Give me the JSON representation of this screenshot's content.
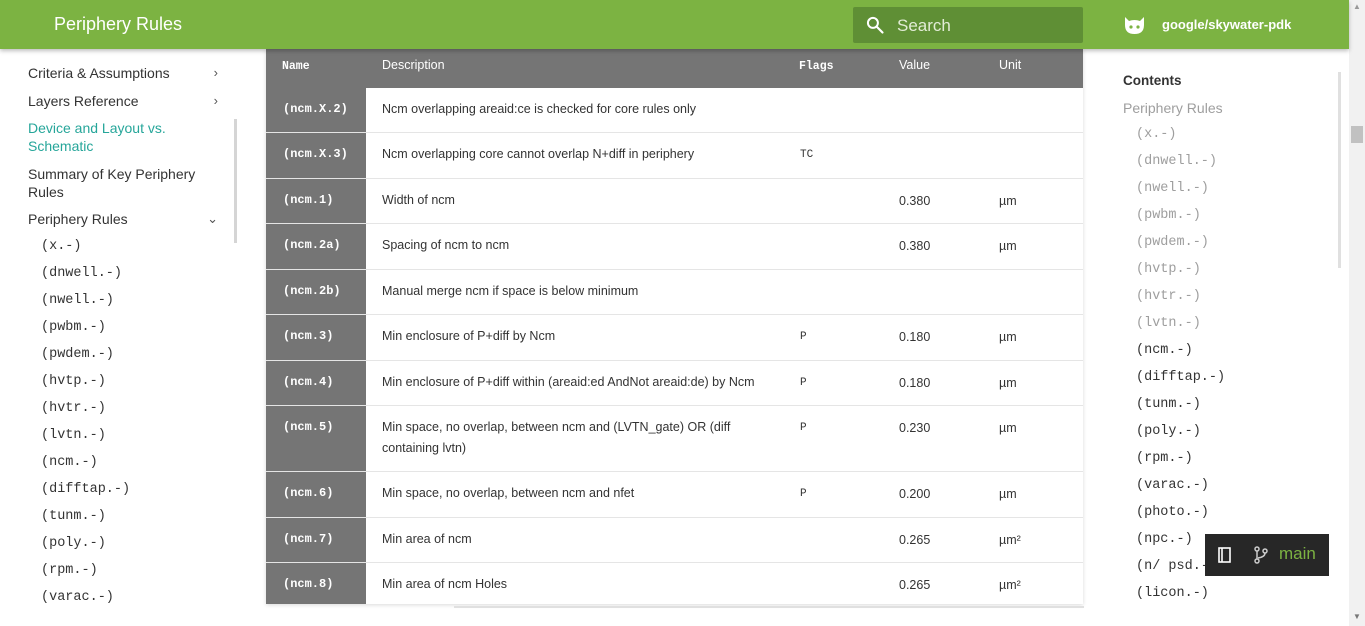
{
  "header": {
    "title": "Periphery Rules",
    "search_placeholder": "Search",
    "repo_name": "google/skywater-pdk",
    "bg_color": "#7cb342"
  },
  "sidebar": {
    "items": [
      {
        "label": "Criteria & Assumptions",
        "chevron": "›"
      },
      {
        "label": "Layers Reference",
        "chevron": "›"
      },
      {
        "label": "Device and Layout vs. Schematic",
        "active": true
      },
      {
        "label": "Summary of Key Periphery Rules"
      },
      {
        "label": "Periphery Rules",
        "chevron": "⌄"
      }
    ],
    "sub_items": [
      "(x.-)",
      "(dnwell.-)",
      "(nwell.-)",
      "(pwbm.-)",
      "(pwdem.-)",
      "(hvtp.-)",
      "(hvtr.-)",
      "(lvtn.-)",
      "(ncm.-)",
      "(difftap.-)",
      "(tunm.-)",
      "(poly.-)",
      "(rpm.-)",
      "(varac.-)"
    ]
  },
  "table": {
    "headers": {
      "name": "Name",
      "description": "Description",
      "flags": "Flags",
      "value": "Value",
      "unit": "Unit"
    },
    "rows": [
      {
        "name": "(ncm.X.2)",
        "description": "Ncm overlapping areaid:ce is checked for core rules only",
        "flags": "",
        "value": "",
        "unit": ""
      },
      {
        "name": "(ncm.X.3)",
        "description": "Ncm overlapping core cannot overlap N+diff in periphery",
        "flags": "TC",
        "value": "",
        "unit": ""
      },
      {
        "name": "(ncm.1)",
        "description": "Width of ncm",
        "flags": "",
        "value": "0.380",
        "unit": "µm"
      },
      {
        "name": "(ncm.2a)",
        "description": "Spacing of ncm to ncm",
        "flags": "",
        "value": "0.380",
        "unit": "µm"
      },
      {
        "name": "(ncm.2b)",
        "description": "Manual merge ncm if space is below minimum",
        "flags": "",
        "value": "",
        "unit": ""
      },
      {
        "name": "(ncm.3)",
        "description": "Min enclosure of P+diff by Ncm",
        "flags": "P",
        "value": "0.180",
        "unit": "µm"
      },
      {
        "name": "(ncm.4)",
        "description": "Min enclosure of P+diff within (areaid:ed AndNot areaid:de) by Ncm",
        "flags": "P",
        "value": "0.180",
        "unit": "µm"
      },
      {
        "name": "(ncm.5)",
        "description": "Min space, no overlap, between ncm and (LVTN_gate) OR (diff containing lvtn)",
        "flags": "P",
        "value": "0.230",
        "unit": "µm"
      },
      {
        "name": "(ncm.6)",
        "description": "Min space, no overlap, between ncm and nfet",
        "flags": "P",
        "value": "0.200",
        "unit": "µm"
      },
      {
        "name": "(ncm.7)",
        "description": "Min area of ncm",
        "flags": "",
        "value": "0.265",
        "unit": "µm²"
      },
      {
        "name": "(ncm.8)",
        "description": "Min area of ncm Holes",
        "flags": "",
        "value": "0.265",
        "unit": "µm²"
      }
    ]
  },
  "toc": {
    "title": "Contents",
    "section": "Periphery Rules",
    "items": [
      "(x.-)",
      "(dnwell.-)",
      "(nwell.-)",
      "(pwbm.-)",
      "(pwdem.-)",
      "(hvtp.-)",
      "(hvtr.-)",
      "(lvtn.-)",
      "(ncm.-)",
      "(difftap.-)",
      "(tunm.-)",
      "(poly.-)",
      "(rpm.-)",
      "(varac.-)",
      "(photo.-)",
      "(npc.-)",
      "(n/ psd.-)",
      "(licon.-)"
    ],
    "visited_count": 8
  },
  "version_badge": {
    "label": "main"
  }
}
